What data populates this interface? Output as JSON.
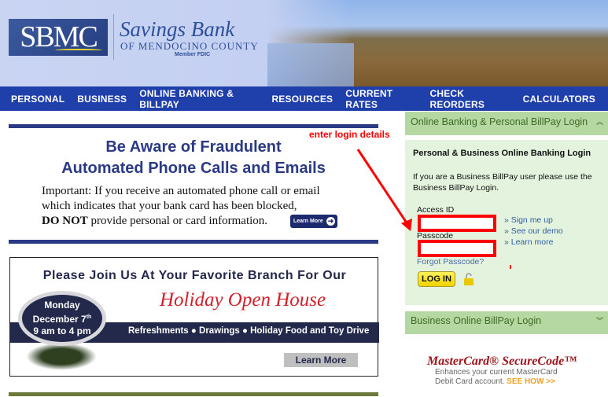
{
  "header": {
    "logo_text": "SBMC",
    "bank_name": "Savings Bank",
    "bank_subtitle": "OF MENDOCINO COUNTY",
    "member": "Member FDIC"
  },
  "nav": {
    "items": [
      "PERSONAL",
      "BUSINESS",
      "ONLINE BANKING & BILLPAY",
      "RESOURCES",
      "CURRENT RATES",
      "CHECK REORDERS",
      "CALCULATORS"
    ]
  },
  "alert": {
    "title_line1": "Be Aware of Fraudulent",
    "title_line2": "Automated Phone Calls and Emails",
    "body_line1": "Important: If you receive an automated phone call or email",
    "body_line2": "which indicates that your bank card has been blocked,",
    "body_bold": "DO NOT",
    "body_line3": " provide personal or card information.",
    "learn_more": "Learn More"
  },
  "banner": {
    "title": "Please Join Us At Your Favorite Branch For Our",
    "script": "Holiday Open House",
    "day": "Monday",
    "date": "December 7",
    "date_sup": "th",
    "hours": "9 am to 4 pm",
    "features": "Refreshments ● Drawings ● Holiday Food and Toy Drive",
    "learn_more": "Learn More"
  },
  "login": {
    "header": "Online Banking & Personal BillPay Login",
    "title": "Personal & Business Online Banking Login",
    "info": "If you are a Business BillPay user please use the Business BillPay Login.",
    "access_label": "Access ID",
    "access_value": "",
    "passcode_label": "Passcode",
    "passcode_value": "",
    "forgot": "Forgot Passcode?",
    "links": [
      "» Sign me up",
      "» See our demo",
      "» Learn more"
    ],
    "button": "LOG IN"
  },
  "business": {
    "header": "Business Online BillPay Login"
  },
  "mastercard": {
    "title": "MasterCard® SecureCode™",
    "line1": "Enhances your current MasterCard",
    "line2": "Debit Card account.",
    "see_how": "SEE HOW >>"
  },
  "annotation": {
    "text": "enter login details",
    "color": "#ff0000"
  },
  "colors": {
    "nav": "#1f3fab",
    "panel_header": "#b5d7a2",
    "panel_body": "#e3f3dd",
    "navy": "#2b3a84"
  }
}
